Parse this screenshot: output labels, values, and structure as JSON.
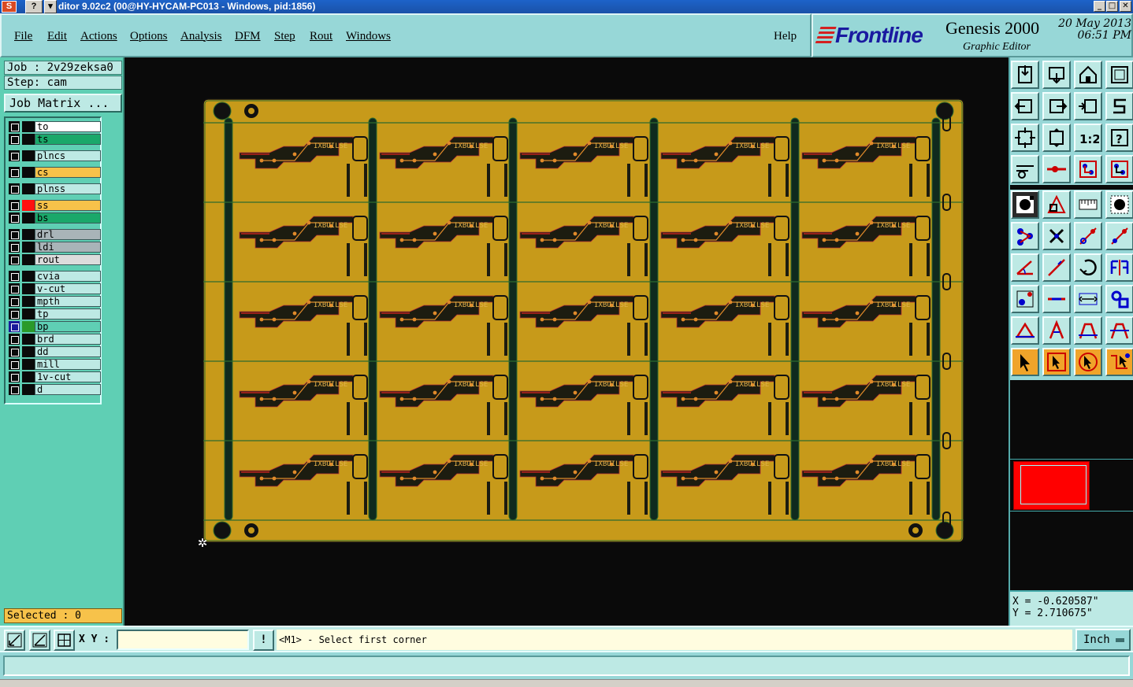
{
  "window": {
    "title": "ditor 9.02c2 (00@HY-HYCAM-PC013 - Windows, pid:1856)",
    "app_icon": "S",
    "help_btn": "?",
    "menu_btn": "▾",
    "controls": [
      "_",
      "□",
      "✕"
    ]
  },
  "menu": {
    "items": [
      "File",
      "Edit",
      "Actions",
      "Options",
      "Analysis",
      "DFM",
      "Step",
      "Rout",
      "Windows"
    ],
    "help": "Help"
  },
  "brand": {
    "logo": "Frontline",
    "product": "Genesis 2000",
    "subtitle": "Graphic Editor",
    "date": "20 May 2013",
    "time": "06:51 PM"
  },
  "left": {
    "job": "Job : 2v29zeksa0",
    "step": "Step: cam",
    "job_matrix": "Job Matrix ...",
    "layers": [
      {
        "name": "to",
        "color": "#ffffff",
        "swatch": ""
      },
      {
        "name": "ts",
        "color": "#1aa86a",
        "swatch": ""
      },
      {
        "name": "plncs",
        "color": "#bde9e4",
        "swatch": ""
      },
      {
        "name": "cs",
        "color": "#f7c24a",
        "swatch": ""
      },
      {
        "name": "plnss",
        "color": "#bde9e4",
        "swatch": ""
      },
      {
        "name": "ss",
        "color": "#f7c24a",
        "swatch": "#ff1010"
      },
      {
        "name": "bs",
        "color": "#1aa86a",
        "swatch": ""
      },
      {
        "name": "drl",
        "color": "#a9b4b8",
        "swatch": ""
      },
      {
        "name": "ldi",
        "color": "#a9b4b8",
        "swatch": ""
      },
      {
        "name": "rout",
        "color": "#dcdcdc",
        "swatch": ""
      },
      {
        "name": "cvia",
        "color": "#bde9e4",
        "swatch": ""
      },
      {
        "name": "v-cut",
        "color": "#bde9e4",
        "swatch": ""
      },
      {
        "name": "mpth",
        "color": "#bde9e4",
        "swatch": ""
      },
      {
        "name": "tp",
        "color": "#bde9e4",
        "swatch": ""
      },
      {
        "name": "bp",
        "color": "#5fcfb4",
        "swatch": "#2a9a2a"
      },
      {
        "name": "brd",
        "color": "#bde9e4",
        "swatch": ""
      },
      {
        "name": "dd",
        "color": "#bde9e4",
        "swatch": ""
      },
      {
        "name": "mill",
        "color": "#bde9e4",
        "swatch": ""
      },
      {
        "name": "1v-cut",
        "color": "#bde9e4",
        "swatch": ""
      },
      {
        "name": "d",
        "color": "#bde9e4",
        "swatch": ""
      }
    ],
    "selected": "Selected : 0"
  },
  "panel": {
    "rows": 5,
    "cols": 5,
    "board_color": "#c79a1a",
    "trace_color": "#1c1c10",
    "pad_color": "#e08a2a",
    "board_label": "IXBUILSE"
  },
  "coords": {
    "x": "X = -0.620587\"",
    "y": "Y = 2.710675\""
  },
  "command": {
    "xy_label": "X Y :",
    "xy_value": "",
    "bang": "!",
    "prompt": "<M1> - Select first corner",
    "units": "Inch"
  },
  "tools": [
    {
      "name": "open-step-icon"
    },
    {
      "name": "save-icon"
    },
    {
      "name": "home-icon"
    },
    {
      "name": "window-icon"
    },
    {
      "name": "pan-left-icon"
    },
    {
      "name": "pan-right-icon"
    },
    {
      "name": "mirror-icon"
    },
    {
      "name": "s-curve-icon"
    },
    {
      "name": "zoom-fit-icon"
    },
    {
      "name": "zoom-center-icon"
    },
    {
      "name": "scale-1-2-icon"
    },
    {
      "name": "query-icon"
    },
    {
      "name": "measure-icon"
    },
    {
      "name": "snap-icon"
    },
    {
      "name": "net-icon"
    },
    {
      "name": "net-alt-icon"
    },
    {
      "name": "pad-icon"
    },
    {
      "name": "edit-shape-icon"
    },
    {
      "name": "ruler-icon"
    },
    {
      "name": "circle-icon"
    },
    {
      "name": "route-icon"
    },
    {
      "name": "cross-icon"
    },
    {
      "name": "line-node-icon"
    },
    {
      "name": "line-node-alt-icon"
    },
    {
      "name": "angle-icon"
    },
    {
      "name": "diagonal-icon"
    },
    {
      "name": "arc-icon"
    },
    {
      "name": "flip-icon"
    },
    {
      "name": "node-move-icon"
    },
    {
      "name": "split-icon"
    },
    {
      "name": "dimension-icon"
    },
    {
      "name": "connect-icon"
    },
    {
      "name": "triangle-icon"
    },
    {
      "name": "triangle-up-icon"
    },
    {
      "name": "trapezoid-icon"
    },
    {
      "name": "trapezoid-alt-icon"
    },
    {
      "name": "pointer-icon"
    },
    {
      "name": "pointer-box-icon"
    },
    {
      "name": "pointer-alt-icon"
    },
    {
      "name": "pointer-net-icon"
    }
  ]
}
